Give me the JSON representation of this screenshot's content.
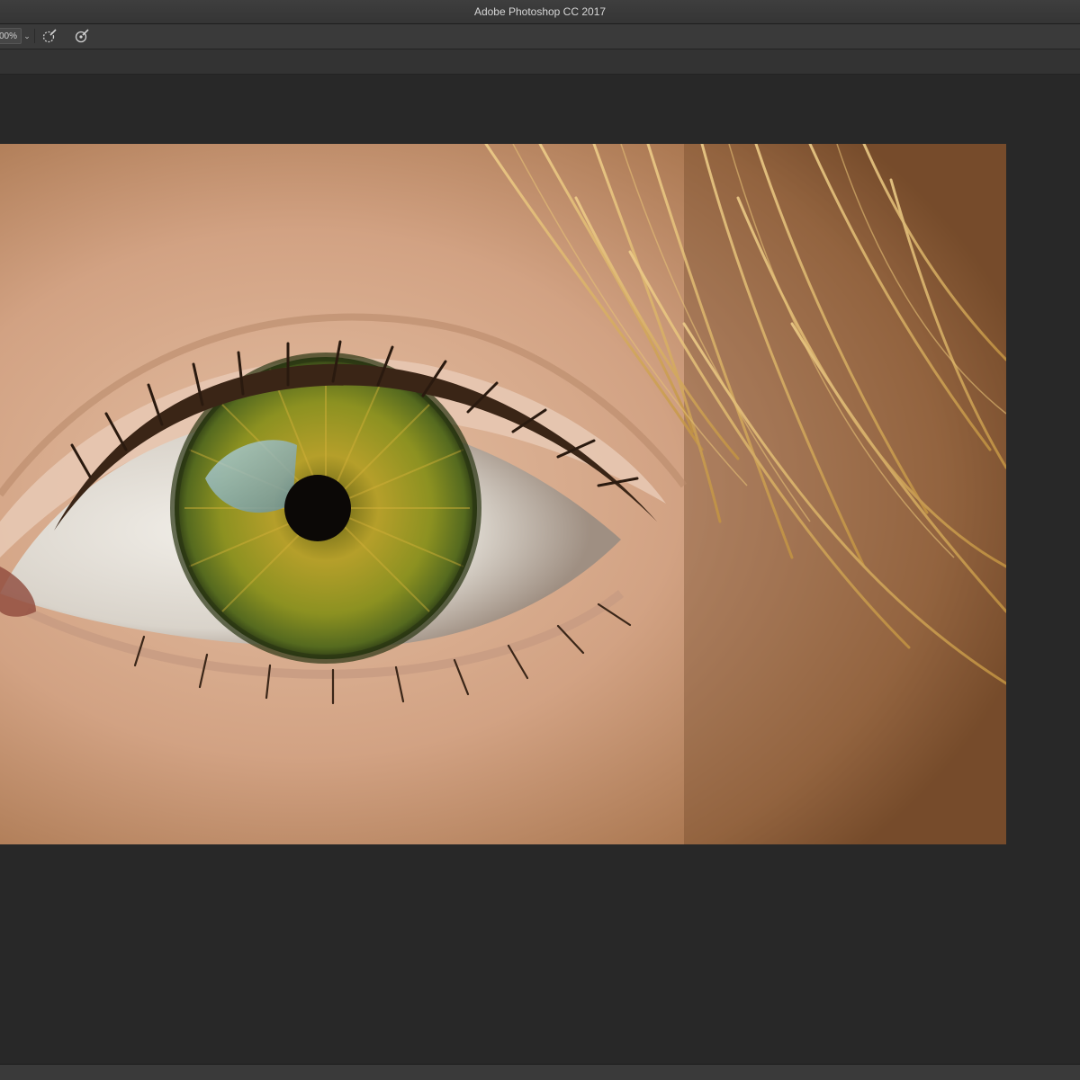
{
  "window": {
    "title": "Adobe Photoshop CC 2017"
  },
  "options_bar": {
    "zoom_value": "00%",
    "dropdown_icon": "chevron-down-icon",
    "tool1_icon": "refine-brush-icon",
    "tool2_icon": "brush-settings-icon"
  },
  "document": {
    "image_subject": "close-up-eye-photo"
  },
  "colors": {
    "ui_background": "#282828",
    "titlebar": "#3a3a3a",
    "iris": "#8a8a1e"
  }
}
